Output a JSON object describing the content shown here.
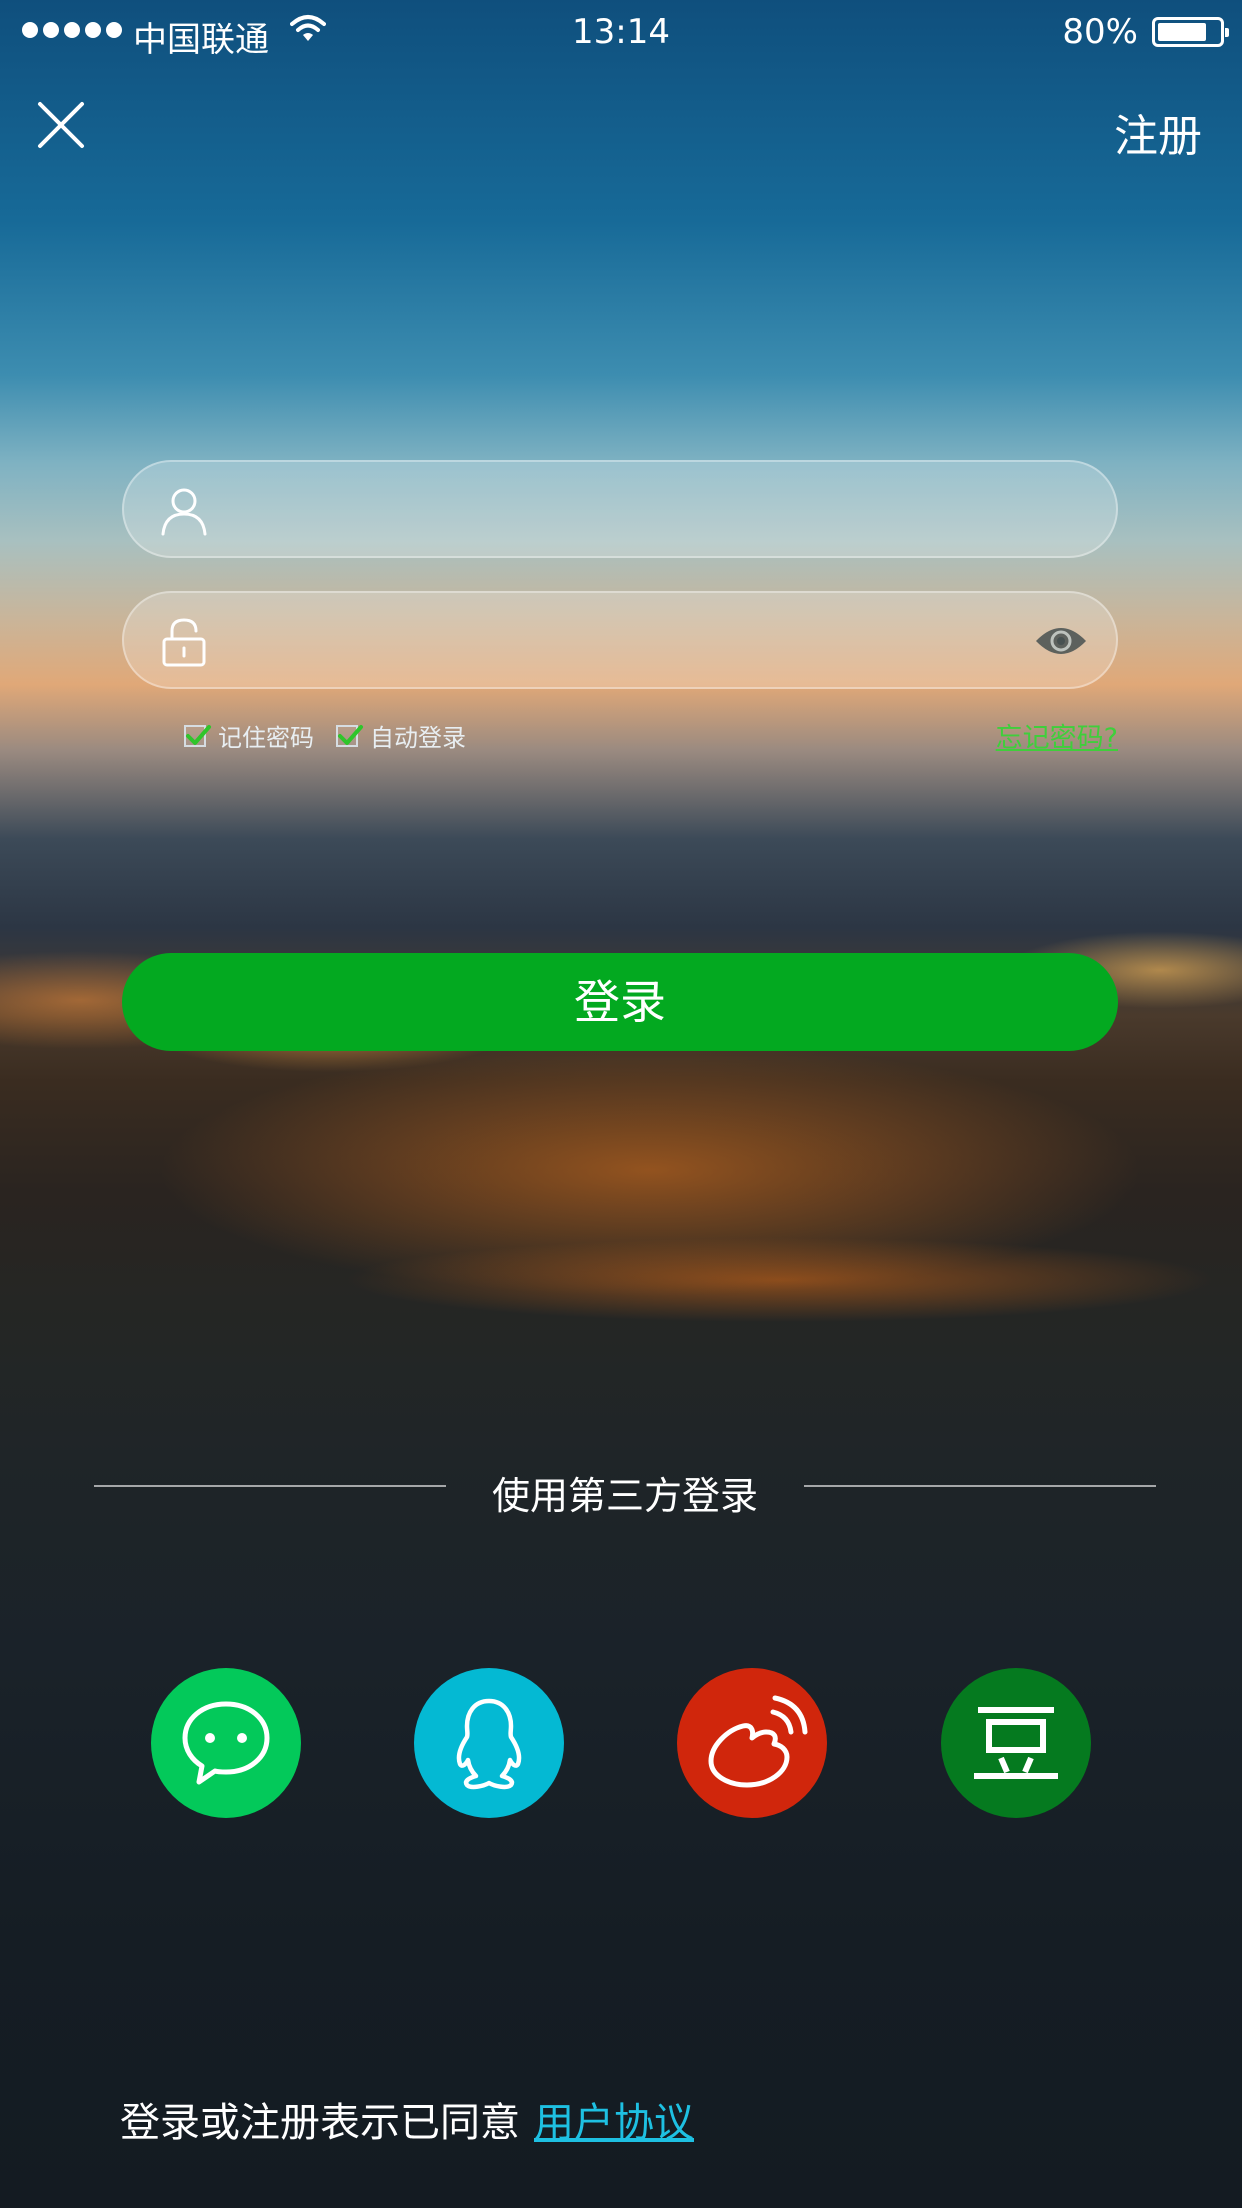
{
  "status_bar": {
    "carrier": "中国联通",
    "time": "13:14",
    "battery_percent": "80%",
    "battery_level": 0.8,
    "signal_bars": 5
  },
  "header": {
    "close_icon": "close-icon",
    "register_label": "注册"
  },
  "form": {
    "username": {
      "value": "",
      "placeholder": "",
      "icon": "user-icon"
    },
    "password": {
      "value": "",
      "placeholder": "",
      "icon": "lock-icon",
      "toggle_icon": "eye-icon"
    },
    "remember_password_label": "记住密码",
    "remember_password_checked": true,
    "auto_login_label": "自动登录",
    "auto_login_checked": true,
    "forgot_password_label": "忘记密码?",
    "login_button_label": "登录"
  },
  "third_party": {
    "label": "使用第三方登录",
    "providers": [
      {
        "icon": "wechat-icon",
        "color": "#03c95a"
      },
      {
        "icon": "qq-icon",
        "color": "#04b9d3"
      },
      {
        "icon": "weibo-icon",
        "color": "#d0260c"
      },
      {
        "icon": "douban-icon",
        "color": "#057a1f"
      }
    ]
  },
  "footer": {
    "agreement_text": "登录或注册表示已同意",
    "agreement_link": "用户协议"
  },
  "colors": {
    "login_button": "#03a920",
    "forgot_link": "#3fcf3b",
    "agreement_link": "#1ec0e2"
  }
}
